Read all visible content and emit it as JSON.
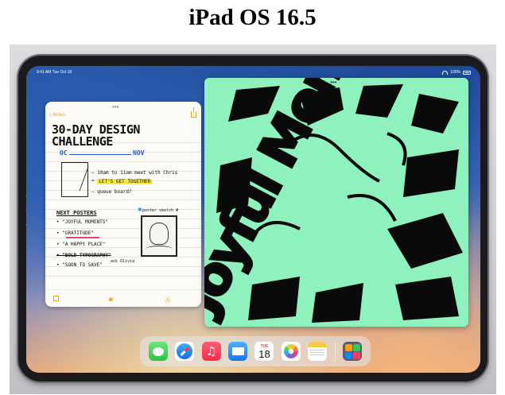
{
  "page": {
    "title": "iPad OS 16.5"
  },
  "status_bar": {
    "time": "9:41 AM  Tue Oct 18",
    "battery": "100%"
  },
  "notes": {
    "back_label": "Notes",
    "title_line1": "30-DAY DESIGN",
    "title_line2": "CHALLENGE",
    "month_oct": "OC",
    "month_nov": "NOV",
    "item1": "— 10am to 11am meet with Chris",
    "item2": "LET'S GET TOGETHER",
    "item3": "— queue board?",
    "next_posters": "NEXT POSTERS",
    "list1": "• \"JOYFUL MOMENTS\"",
    "list2": "• \"GRATITUDE\"",
    "list3": "• \"A HAPPY PLACE\"",
    "list4": "• \"BOLD TYPOGRAPHY\"",
    "list5": "• \"SOON TO SAVE\"",
    "poster_sketch_label": "poster sketch #",
    "ask_olivia": "ask Olivia"
  },
  "art": {
    "lettering": "Joyful Moment"
  },
  "dock": {
    "calendar_weekday": "TUE",
    "calendar_date": "18",
    "music_glyph": "♫",
    "apps": [
      "Messages",
      "Safari",
      "Music",
      "Mail",
      "Calendar",
      "Photos",
      "Notes",
      "App Library"
    ],
    "suggested_colors": [
      "#ff9f0a",
      "#34c759",
      "#0a84ff",
      "#ff375f"
    ]
  }
}
